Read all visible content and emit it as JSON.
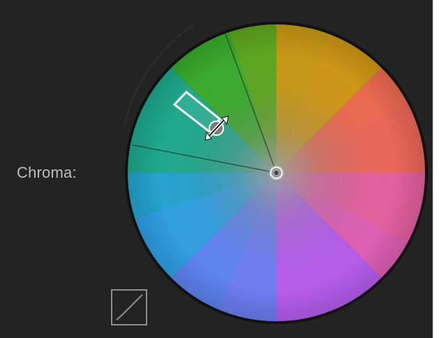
{
  "panel": {
    "label": "Chroma:"
  },
  "colors": {
    "background": "#232323",
    "label_text": "#bdbdbd",
    "wheel_outline": "#111111",
    "handle_outline": "#ffffff",
    "center_point": "#9c9c9c",
    "curve_icon_outline": "#8f8f8f"
  },
  "icons": {
    "curve": "curve-icon",
    "drag_handle": "drag-handle-icon",
    "center": "center-point-icon"
  }
}
